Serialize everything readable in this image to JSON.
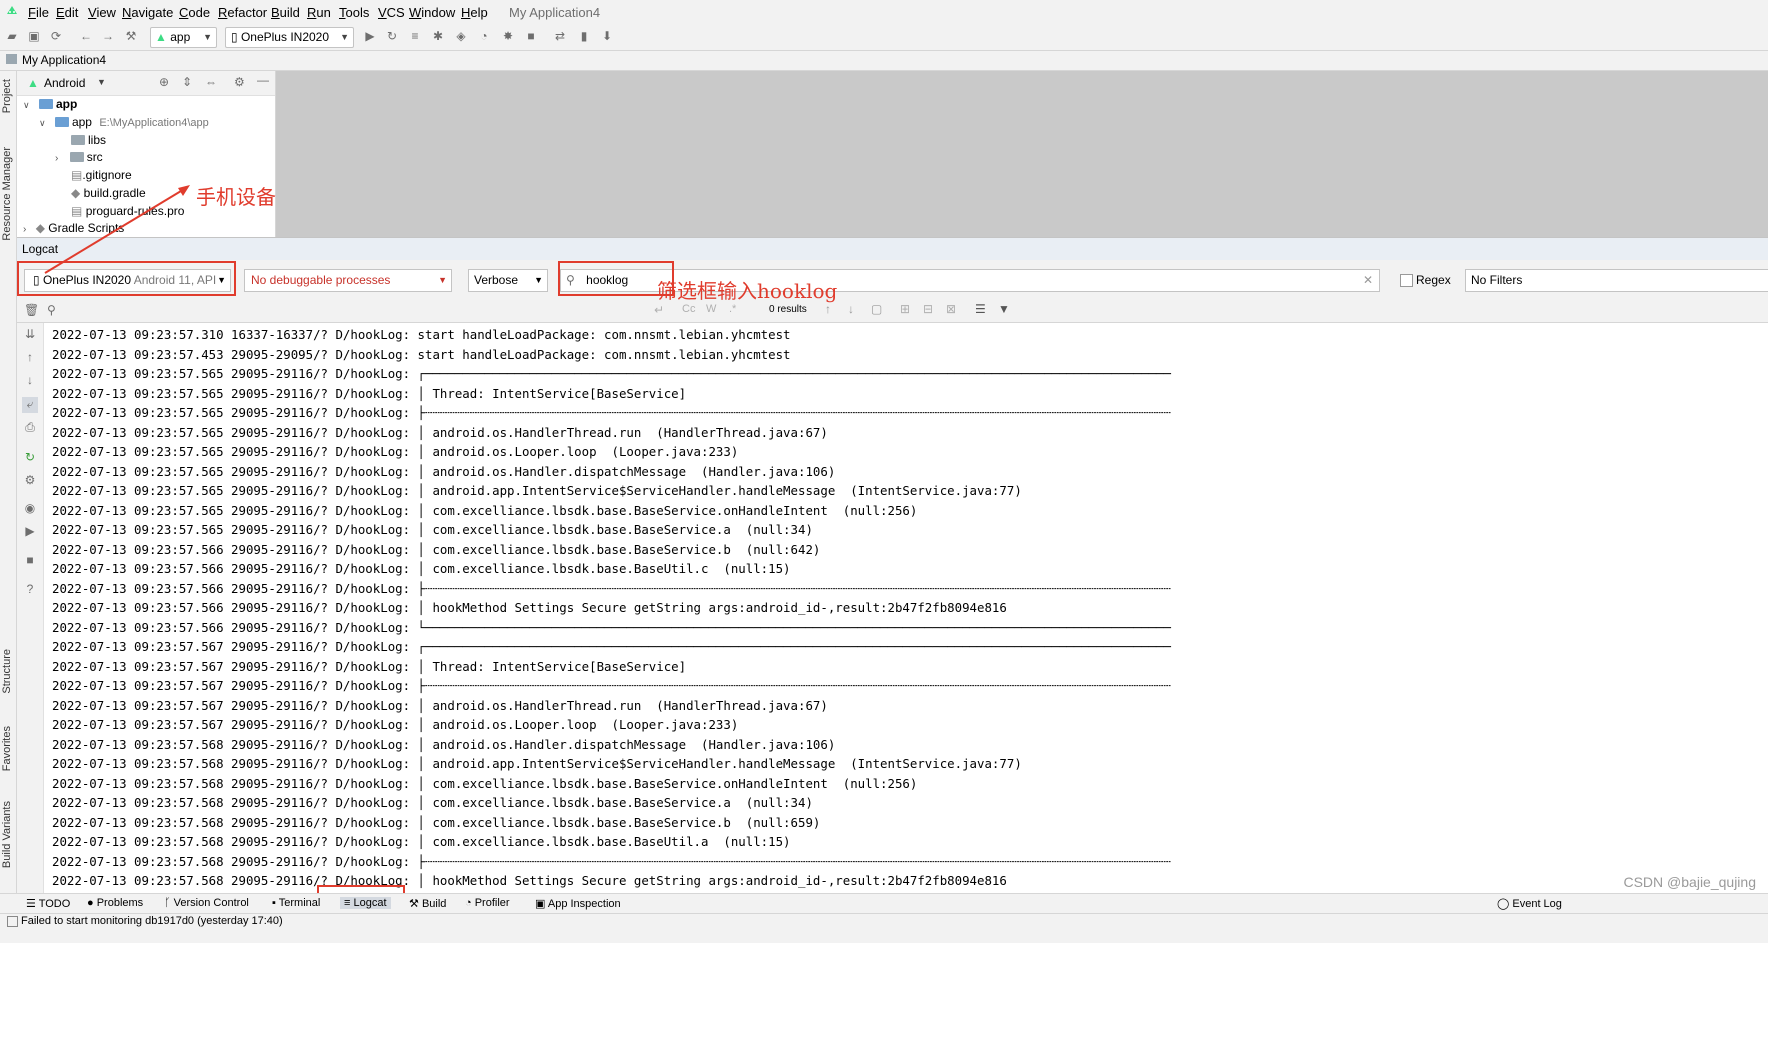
{
  "menubar": {
    "items": [
      "File",
      "Edit",
      "View",
      "Navigate",
      "Code",
      "Refactor",
      "Build",
      "Run",
      "Tools",
      "VCS",
      "Window",
      "Help"
    ],
    "app_title": "My Application4"
  },
  "toolbar": {
    "module": "app",
    "device": "OnePlus IN2020"
  },
  "navbar": {
    "breadcrumb": "My Application4"
  },
  "side_labels": {
    "project": "Project",
    "resource_manager": "Resource Manager",
    "structure": "Structure",
    "favorites": "Favorites",
    "build_variants": "Build Variants"
  },
  "project_panel": {
    "view": "Android",
    "tree": [
      {
        "label": "app",
        "bold": true
      },
      {
        "label": "app",
        "path": "E:\\MyApplication4\\app"
      },
      {
        "label": "libs"
      },
      {
        "label": "src"
      },
      {
        "label": ".gitignore"
      },
      {
        "label": "build.gradle"
      },
      {
        "label": "proguard-rules.pro"
      },
      {
        "label": "Gradle Scripts"
      }
    ]
  },
  "logcat": {
    "title": "Logcat",
    "device": "OnePlus IN2020",
    "device_detail": "Android 11, API",
    "process": "No debuggable processes",
    "level": "Verbose",
    "filter": "hooklog",
    "regex_label": "Regex",
    "filters_combo": "No Filters",
    "results": "0 results",
    "lines": [
      "2022-07-13 09:23:57.310 16337-16337/? D/hookLog: start handleLoadPackage: com.nnsmt.lebian.yhcmtest",
      "2022-07-13 09:23:57.453 29095-29095/? D/hookLog: start handleLoadPackage: com.nnsmt.lebian.yhcmtest",
      "2022-07-13 09:23:57.565 29095-29116/? D/hookLog: ┌────────────────────────────────────────────────────────────────────────────────────────────────────",
      "2022-07-13 09:23:57.565 29095-29116/? D/hookLog: │ Thread: IntentService[BaseService]",
      "2022-07-13 09:23:57.565 29095-29116/? D/hookLog: ├┄┄┄┄┄┄┄┄┄┄┄┄┄┄┄┄┄┄┄┄┄┄┄┄┄┄┄┄┄┄┄┄┄┄┄┄┄┄┄┄┄┄┄┄┄┄┄┄┄┄┄┄┄┄┄┄┄┄┄┄┄┄┄┄┄┄┄┄┄┄┄┄┄┄┄┄┄┄┄┄┄┄┄┄┄┄┄┄┄┄┄┄┄┄┄┄┄┄┄┄",
      "2022-07-13 09:23:57.565 29095-29116/? D/hookLog: │ android.os.HandlerThread.run  (HandlerThread.java:67)",
      "2022-07-13 09:23:57.565 29095-29116/? D/hookLog: │ android.os.Looper.loop  (Looper.java:233)",
      "2022-07-13 09:23:57.565 29095-29116/? D/hookLog: │ android.os.Handler.dispatchMessage  (Handler.java:106)",
      "2022-07-13 09:23:57.565 29095-29116/? D/hookLog: │ android.app.IntentService$ServiceHandler.handleMessage  (IntentService.java:77)",
      "2022-07-13 09:23:57.565 29095-29116/? D/hookLog: │ com.excelliance.lbsdk.base.BaseService.onHandleIntent  (null:256)",
      "2022-07-13 09:23:57.565 29095-29116/? D/hookLog: │ com.excelliance.lbsdk.base.BaseService.a  (null:34)",
      "2022-07-13 09:23:57.566 29095-29116/? D/hookLog: │ com.excelliance.lbsdk.base.BaseService.b  (null:642)",
      "2022-07-13 09:23:57.566 29095-29116/? D/hookLog: │ com.excelliance.lbsdk.base.BaseUtil.c  (null:15)",
      "2022-07-13 09:23:57.566 29095-29116/? D/hookLog: ├┄┄┄┄┄┄┄┄┄┄┄┄┄┄┄┄┄┄┄┄┄┄┄┄┄┄┄┄┄┄┄┄┄┄┄┄┄┄┄┄┄┄┄┄┄┄┄┄┄┄┄┄┄┄┄┄┄┄┄┄┄┄┄┄┄┄┄┄┄┄┄┄┄┄┄┄┄┄┄┄┄┄┄┄┄┄┄┄┄┄┄┄┄┄┄┄┄┄┄┄",
      "2022-07-13 09:23:57.566 29095-29116/? D/hookLog: │ hookMethod Settings Secure getString args:android_id-,result:2b47f2fb8094e816",
      "2022-07-13 09:23:57.566 29095-29116/? D/hookLog: └────────────────────────────────────────────────────────────────────────────────────────────────────",
      "2022-07-13 09:23:57.567 29095-29116/? D/hookLog: ┌────────────────────────────────────────────────────────────────────────────────────────────────────",
      "2022-07-13 09:23:57.567 29095-29116/? D/hookLog: │ Thread: IntentService[BaseService]",
      "2022-07-13 09:23:57.567 29095-29116/? D/hookLog: ├┄┄┄┄┄┄┄┄┄┄┄┄┄┄┄┄┄┄┄┄┄┄┄┄┄┄┄┄┄┄┄┄┄┄┄┄┄┄┄┄┄┄┄┄┄┄┄┄┄┄┄┄┄┄┄┄┄┄┄┄┄┄┄┄┄┄┄┄┄┄┄┄┄┄┄┄┄┄┄┄┄┄┄┄┄┄┄┄┄┄┄┄┄┄┄┄┄┄┄┄",
      "2022-07-13 09:23:57.567 29095-29116/? D/hookLog: │ android.os.HandlerThread.run  (HandlerThread.java:67)",
      "2022-07-13 09:23:57.567 29095-29116/? D/hookLog: │ android.os.Looper.loop  (Looper.java:233)",
      "2022-07-13 09:23:57.568 29095-29116/? D/hookLog: │ android.os.Handler.dispatchMessage  (Handler.java:106)",
      "2022-07-13 09:23:57.568 29095-29116/? D/hookLog: │ android.app.IntentService$ServiceHandler.handleMessage  (IntentService.java:77)",
      "2022-07-13 09:23:57.568 29095-29116/? D/hookLog: │ com.excelliance.lbsdk.base.BaseService.onHandleIntent  (null:256)",
      "2022-07-13 09:23:57.568 29095-29116/? D/hookLog: │ com.excelliance.lbsdk.base.BaseService.a  (null:34)",
      "2022-07-13 09:23:57.568 29095-29116/? D/hookLog: │ com.excelliance.lbsdk.base.BaseService.b  (null:659)",
      "2022-07-13 09:23:57.568 29095-29116/? D/hookLog: │ com.excelliance.lbsdk.base.BaseUtil.a  (null:15)",
      "2022-07-13 09:23:57.568 29095-29116/? D/hookLog: ├┄┄┄┄┄┄┄┄┄┄┄┄┄┄┄┄┄┄┄┄┄┄┄┄┄┄┄┄┄┄┄┄┄┄┄┄┄┄┄┄┄┄┄┄┄┄┄┄┄┄┄┄┄┄┄┄┄┄┄┄┄┄┄┄┄┄┄┄┄┄┄┄┄┄┄┄┄┄┄┄┄┄┄┄┄┄┄┄┄┄┄┄┄┄┄┄┄┄┄┄",
      "2022-07-13 09:23:57.568 29095-29116/? D/hookLog: │ hookMethod Settings Secure getString args:android_id-,result:2b47f2fb8094e816"
    ]
  },
  "annotations": {
    "device_note": "手机设备",
    "filter_note": "筛选框输入hooklog"
  },
  "bottom_tabs": [
    "TODO",
    "Problems",
    "Version Control",
    "Terminal",
    "Logcat",
    "Build",
    "Profiler",
    "App Inspection"
  ],
  "event_log": "Event Log",
  "status_text": "Failed to start monitoring db1917d0 (yesterday 17:40)",
  "watermark": "CSDN @bajie_qujing",
  "colors": {
    "annotation_red": "#e03c2d",
    "panel_gray": "#f2f2f2",
    "editor_gray": "#c9c9c9"
  }
}
